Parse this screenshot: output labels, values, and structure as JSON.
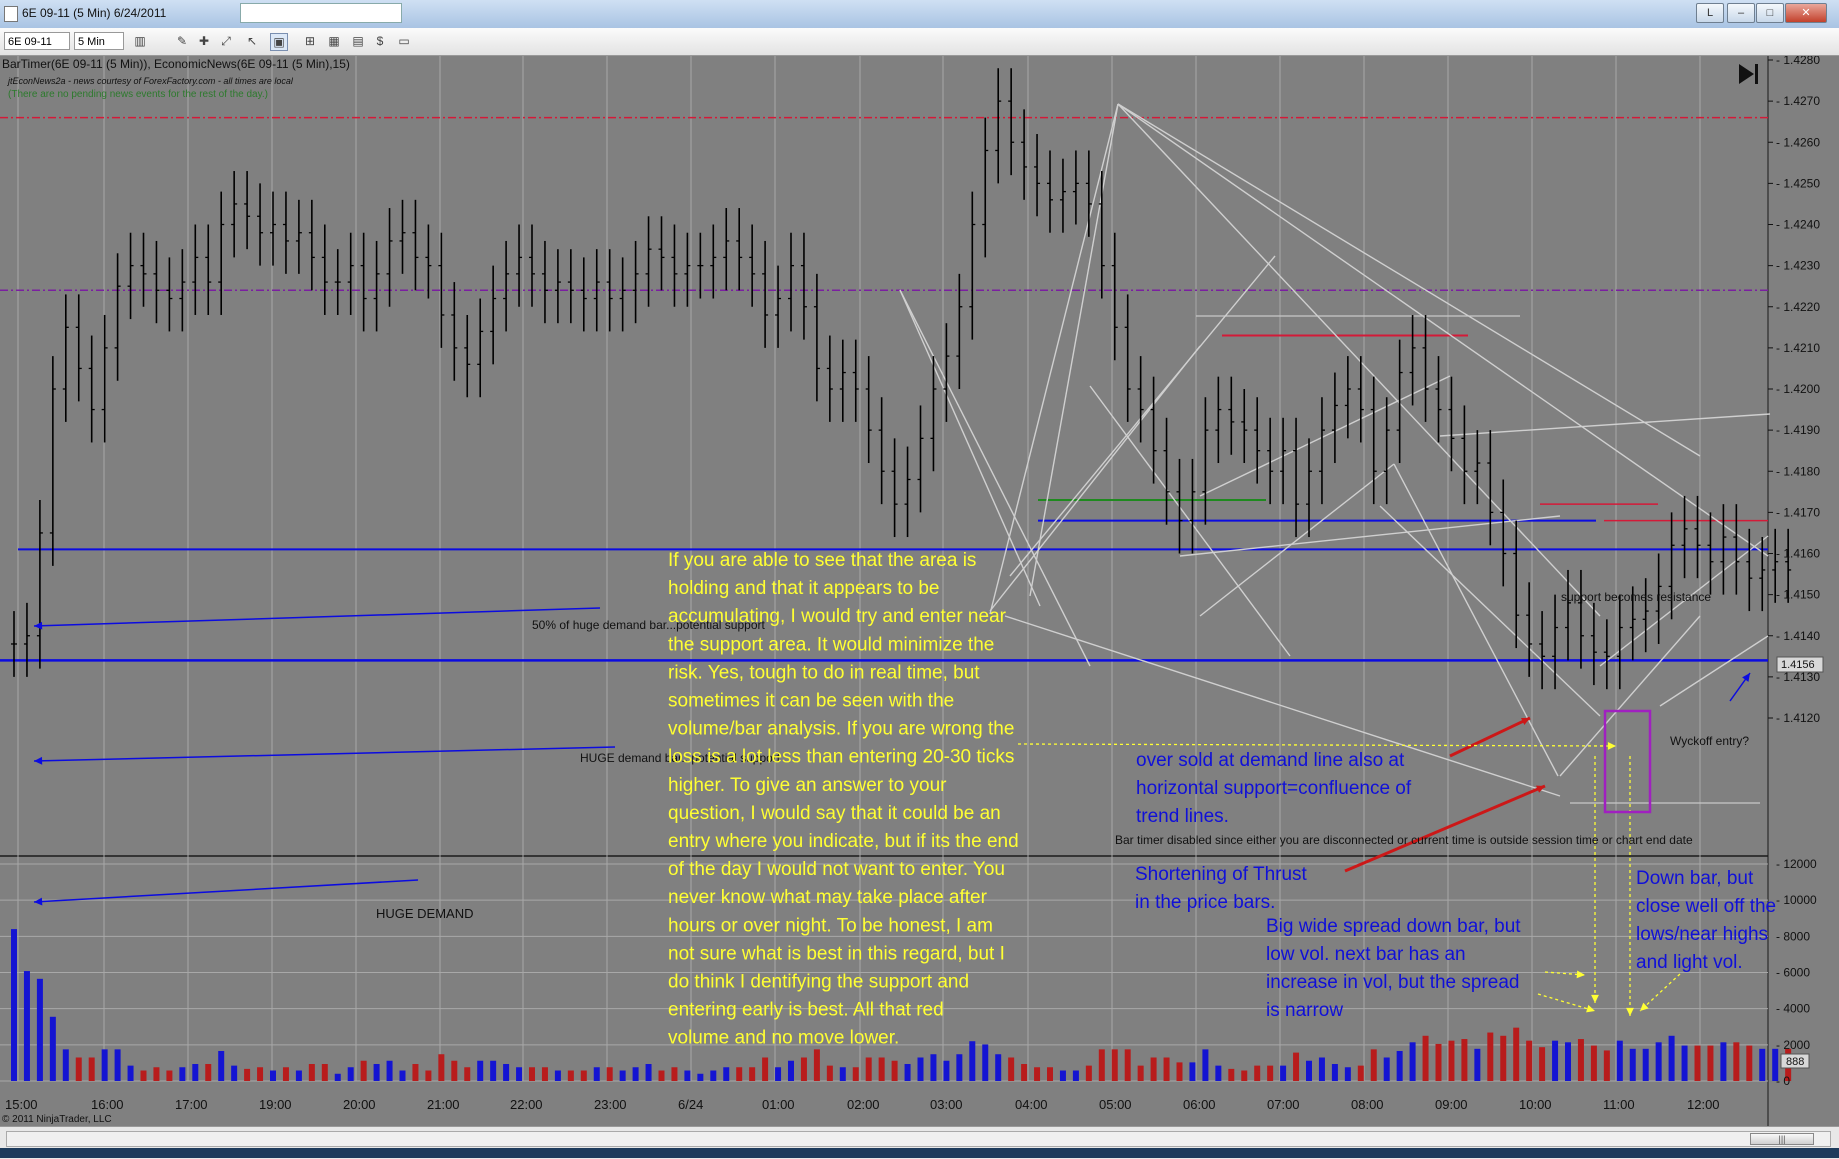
{
  "window": {
    "title": "6E 09-11 (5 Min)  6/24/2011",
    "buttons": {
      "l": "L",
      "min": "–",
      "max": "□",
      "close": "✕"
    }
  },
  "toolbar": {
    "instrument": "6E 09-11",
    "interval": "5 Min",
    "icons": [
      "bar-style-icon",
      "draw-pencil-icon",
      "crosshair-icon",
      "zoom-icon",
      "data-box-icon",
      "indicators-icon",
      "strategy-icon",
      "properties-icon",
      "dollar-icon",
      "sheet-icon"
    ]
  },
  "chart": {
    "indicator_header": "BarTimer(6E 09-11 (5 Min)), EconomicNews(6E 09-11 (5 Min),15)",
    "news_line1": "jtEconNews2a - news courtesy of ForexFactory.com - all times are local",
    "news_line2": "(There are no pending news events for the rest of the day.)",
    "bartimer_msg": "Bar timer disabled since either you are disconnected or current time is outside session time or chart end date",
    "copyright": "© 2011 NinjaTrader, LLC",
    "current_price": "1.4156",
    "volume_readout": "888",
    "colors": {
      "bg": "#808080",
      "up_vol": "#1414d2",
      "down_vol": "#b81c1c",
      "blue_line": "#0b0be0",
      "red_line": "#d41a38",
      "green_line": "#1f8a1f",
      "annot_yellow": "#ffff33",
      "annot_blue": "#1010d8"
    }
  },
  "annotations": {
    "half_demand": "50% of huge demand bar...potential support",
    "huge_demand_line": "HUGE demand bar...potential support",
    "huge_demand_vol": "HUGE DEMAND",
    "support_resistance": "support becomes resistance",
    "wyckoff": "Wyckoff entry?",
    "yellow_text": [
      "If you are able to see that the area is",
      "holding and that it appears to be",
      "accumulating, I would try and enter near",
      "the support area.  It would minimize the",
      "risk.  Yes, tough to do in real time, but",
      "sometimes it can be seen with the",
      "volume/bar analysis. If you are wrong the",
      "loss is a lot less than entering 20-30 ticks",
      "higher. To give an answer to your",
      "question, I would say that it could be an",
      "entry where you indicate, but if its the end",
      "of the day I would not want to enter.  You",
      "never know what may take place after",
      "hours or over night.  To be honest, I am",
      "not sure what is best in this regard, but I",
      "do think I dentifying the support and",
      "entering early is best.    All that red",
      "volume and no move lower."
    ],
    "oversold": [
      "over sold at demand line also at",
      "horizontal support=confluence of",
      "trend lines."
    ],
    "thrust": [
      "Shortening of Thrust",
      "in the price bars."
    ],
    "bigwide": [
      "Big wide spread down bar, but",
      "low vol. next bar has an",
      "increase in vol, but the spread",
      "is narrow"
    ],
    "downbar": [
      "Down bar, but",
      "close well off the",
      "lows/near highs",
      "and light vol."
    ]
  },
  "chart_data": {
    "type": "bar",
    "instrument": "6E 09-11",
    "interval": "5 Min",
    "price_axis": {
      "min": 1.412,
      "max": 1.428,
      "ticks": [
        "1.4280",
        "1.4270",
        "1.4260",
        "1.4250",
        "1.4240",
        "1.4230",
        "1.4220",
        "1.4210",
        "1.4200",
        "1.4190",
        "1.4180",
        "1.4170",
        "1.4160",
        "1.4150",
        "1.4140",
        "1.4130",
        "1.4120"
      ]
    },
    "volume_axis": {
      "min": 0,
      "max": 12000,
      "ticks": [
        "12000",
        "10000",
        "8000",
        "6000",
        "4000",
        "2000",
        "0"
      ]
    },
    "time_axis": [
      "15:00",
      "16:00",
      "17:00",
      "19:00",
      "20:00",
      "21:00",
      "22:00",
      "23:00",
      "6/24",
      "01:00",
      "02:00",
      "03:00",
      "04:00",
      "05:00",
      "06:00",
      "07:00",
      "08:00",
      "09:00",
      "10:00",
      "11:00",
      "12:00"
    ],
    "price_path": [
      [
        0,
        1.4138
      ],
      [
        1,
        1.414
      ],
      [
        2,
        1.4165
      ],
      [
        3,
        1.42
      ],
      [
        4,
        1.4215
      ],
      [
        5,
        1.4205
      ],
      [
        6,
        1.4195
      ],
      [
        7,
        1.421
      ],
      [
        8,
        1.4225
      ],
      [
        9,
        1.423
      ],
      [
        10,
        1.4228
      ],
      [
        11,
        1.4224
      ],
      [
        12,
        1.4222
      ],
      [
        13,
        1.4226
      ],
      [
        14,
        1.4232
      ],
      [
        15,
        1.4226
      ],
      [
        16,
        1.424
      ],
      [
        17,
        1.4245
      ],
      [
        18,
        1.4242
      ],
      [
        19,
        1.4238
      ],
      [
        20,
        1.424
      ],
      [
        21,
        1.4236
      ],
      [
        22,
        1.4238
      ],
      [
        23,
        1.4232
      ],
      [
        24,
        1.4226
      ],
      [
        25,
        1.4226
      ],
      [
        26,
        1.423
      ],
      [
        27,
        1.4222
      ],
      [
        28,
        1.4228
      ],
      [
        29,
        1.4236
      ],
      [
        30,
        1.4238
      ],
      [
        31,
        1.4232
      ],
      [
        32,
        1.423
      ],
      [
        33,
        1.4218
      ],
      [
        34,
        1.421
      ],
      [
        35,
        1.4206
      ],
      [
        36,
        1.4214
      ],
      [
        37,
        1.4222
      ],
      [
        38,
        1.4228
      ],
      [
        39,
        1.4232
      ],
      [
        40,
        1.4228
      ],
      [
        41,
        1.4224
      ],
      [
        42,
        1.4226
      ],
      [
        43,
        1.4224
      ],
      [
        44,
        1.4222
      ],
      [
        45,
        1.4226
      ],
      [
        46,
        1.4222
      ],
      [
        47,
        1.4224
      ],
      [
        48,
        1.4228
      ],
      [
        49,
        1.4234
      ],
      [
        50,
        1.4232
      ],
      [
        51,
        1.4228
      ],
      [
        52,
        1.423
      ],
      [
        53,
        1.423
      ],
      [
        54,
        1.4232
      ],
      [
        55,
        1.4236
      ],
      [
        56,
        1.4232
      ],
      [
        57,
        1.4228
      ],
      [
        58,
        1.4218
      ],
      [
        59,
        1.4222
      ],
      [
        60,
        1.423
      ],
      [
        61,
        1.422
      ],
      [
        62,
        1.4205
      ],
      [
        63,
        1.42
      ],
      [
        64,
        1.4204
      ],
      [
        65,
        1.42
      ],
      [
        66,
        1.419
      ],
      [
        67,
        1.418
      ],
      [
        68,
        1.4172
      ],
      [
        69,
        1.4178
      ],
      [
        70,
        1.4188
      ],
      [
        71,
        1.42
      ],
      [
        72,
        1.4208
      ],
      [
        73,
        1.422
      ],
      [
        74,
        1.424
      ],
      [
        75,
        1.4258
      ],
      [
        76,
        1.427
      ],
      [
        77,
        1.426
      ],
      [
        78,
        1.4254
      ],
      [
        79,
        1.425
      ],
      [
        80,
        1.4246
      ],
      [
        81,
        1.4248
      ],
      [
        82,
        1.425
      ],
      [
        83,
        1.4245
      ],
      [
        84,
        1.423
      ],
      [
        85,
        1.4215
      ],
      [
        86,
        1.42
      ],
      [
        87,
        1.4195
      ],
      [
        88,
        1.4185
      ],
      [
        89,
        1.4175
      ],
      [
        90,
        1.4168
      ],
      [
        91,
        1.4175
      ],
      [
        92,
        1.419
      ],
      [
        93,
        1.4195
      ],
      [
        94,
        1.4192
      ],
      [
        95,
        1.419
      ],
      [
        96,
        1.4185
      ],
      [
        97,
        1.418
      ],
      [
        98,
        1.4185
      ],
      [
        99,
        1.4172
      ],
      [
        100,
        1.418
      ],
      [
        101,
        1.419
      ],
      [
        102,
        1.4196
      ],
      [
        103,
        1.42
      ],
      [
        104,
        1.4195
      ],
      [
        105,
        1.418
      ],
      [
        106,
        1.419
      ],
      [
        107,
        1.4204
      ],
      [
        108,
        1.421
      ],
      [
        109,
        1.42
      ],
      [
        110,
        1.4195
      ],
      [
        111,
        1.4188
      ],
      [
        112,
        1.418
      ],
      [
        113,
        1.4182
      ],
      [
        114,
        1.417
      ],
      [
        115,
        1.416
      ],
      [
        116,
        1.4145
      ],
      [
        117,
        1.4138
      ],
      [
        118,
        1.4135
      ],
      [
        119,
        1.4142
      ],
      [
        120,
        1.4148
      ],
      [
        121,
        1.414
      ],
      [
        122,
        1.4136
      ],
      [
        123,
        1.4135
      ],
      [
        124,
        1.4142
      ],
      [
        125,
        1.4144
      ],
      [
        126,
        1.4146
      ],
      [
        127,
        1.4152
      ],
      [
        128,
        1.4162
      ],
      [
        129,
        1.4166
      ],
      [
        130,
        1.4162
      ],
      [
        131,
        1.4158
      ],
      [
        132,
        1.4164
      ],
      [
        133,
        1.4158
      ],
      [
        134,
        1.4154
      ],
      [
        135,
        1.4156
      ],
      [
        136,
        1.4158
      ],
      [
        137,
        1.4156
      ]
    ],
    "levels": {
      "red_top": 1.4266,
      "purple_mid": 1.4224,
      "red_mid": 1.4213,
      "green": 1.4173,
      "blue_support_right": 1.4168,
      "blue_half_demand": 1.4161,
      "blue_huge_demand": 1.4134,
      "red_resistance_a": 1.4172,
      "red_resistance_b": 1.4168
    }
  }
}
